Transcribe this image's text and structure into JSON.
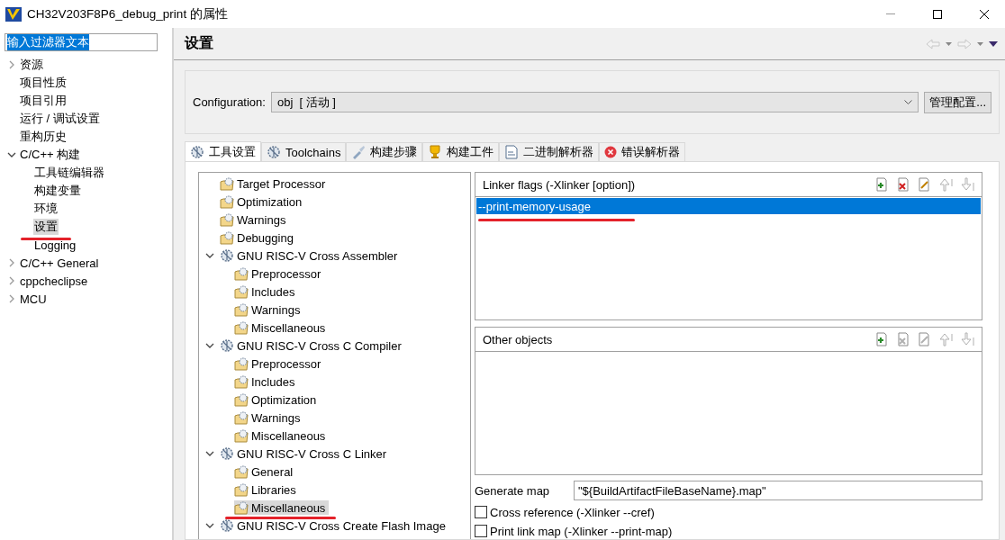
{
  "window": {
    "title": "CH32V203F8P6_debug_print 的属性"
  },
  "filter": {
    "value": "输入过滤器文本"
  },
  "nav_tree": [
    {
      "label": "资源",
      "expanded": false,
      "selected": false
    },
    {
      "label": "项目性质",
      "selected": false
    },
    {
      "label": "项目引用",
      "selected": false
    },
    {
      "label": "运行 / 调试设置",
      "selected": false
    },
    {
      "label": "重构历史",
      "selected": false
    },
    {
      "label": "C/C++ 构建",
      "expanded": true,
      "selected": false,
      "children": [
        {
          "label": "工具链编辑器",
          "selected": false
        },
        {
          "label": "构建变量",
          "selected": false
        },
        {
          "label": "环境",
          "selected": false
        },
        {
          "label": "设置",
          "selected": true,
          "underlined": true
        },
        {
          "label": "Logging",
          "selected": false
        }
      ]
    },
    {
      "label": "C/C++ General",
      "expanded": false,
      "selected": false
    },
    {
      "label": "cppcheclipse",
      "expanded": false,
      "selected": false
    },
    {
      "label": "MCU",
      "expanded": false,
      "selected": false
    }
  ],
  "page_title": "设置",
  "configuration": {
    "label": "Configuration:",
    "value": "obj  [ 活动 ]",
    "manage_button": "管理配置..."
  },
  "tabs": [
    {
      "label": "工具设置",
      "selected": true
    },
    {
      "label": "Toolchains",
      "selected": false
    },
    {
      "label": "构建步骤",
      "selected": false
    },
    {
      "label": "构建工件",
      "selected": false
    },
    {
      "label": "二进制解析器",
      "selected": false
    },
    {
      "label": "错误解析器",
      "selected": false
    }
  ],
  "tool_tree": [
    {
      "kind": "option",
      "label": "Target Processor",
      "selected": false
    },
    {
      "kind": "option",
      "label": "Optimization",
      "selected": false
    },
    {
      "kind": "option",
      "label": "Warnings",
      "selected": false
    },
    {
      "kind": "option",
      "label": "Debugging",
      "selected": false
    },
    {
      "kind": "tool",
      "label": "GNU RISC-V Cross Assembler",
      "expanded": true,
      "selected": false,
      "children": [
        {
          "kind": "option",
          "label": "Preprocessor",
          "selected": false
        },
        {
          "kind": "option",
          "label": "Includes",
          "selected": false
        },
        {
          "kind": "option",
          "label": "Warnings",
          "selected": false
        },
        {
          "kind": "option",
          "label": "Miscellaneous",
          "selected": false
        }
      ]
    },
    {
      "kind": "tool",
      "label": "GNU RISC-V Cross C Compiler",
      "expanded": true,
      "selected": false,
      "children": [
        {
          "kind": "option",
          "label": "Preprocessor",
          "selected": false
        },
        {
          "kind": "option",
          "label": "Includes",
          "selected": false
        },
        {
          "kind": "option",
          "label": "Optimization",
          "selected": false
        },
        {
          "kind": "option",
          "label": "Warnings",
          "selected": false
        },
        {
          "kind": "option",
          "label": "Miscellaneous",
          "selected": false
        }
      ]
    },
    {
      "kind": "tool",
      "label": "GNU RISC-V Cross C Linker",
      "expanded": true,
      "selected": false,
      "children": [
        {
          "kind": "option",
          "label": "General",
          "selected": false
        },
        {
          "kind": "option",
          "label": "Libraries",
          "selected": false
        },
        {
          "kind": "option",
          "label": "Miscellaneous",
          "selected": true,
          "underlined": true
        }
      ]
    },
    {
      "kind": "tool",
      "label": "GNU RISC-V Cross Create Flash Image",
      "expanded": true,
      "selected": false
    }
  ],
  "lists": [
    {
      "title": "Linker flags (-Xlinker [option])",
      "items": [
        {
          "text": "--print-memory-usage",
          "selected": true,
          "underlined": true
        }
      ]
    },
    {
      "title": "Other objects"
    }
  ],
  "generate_map": {
    "label": "Generate map",
    "value": "\"${BuildArtifactFileBaseName}.map\""
  },
  "checkboxes": [
    {
      "label": "Cross reference (-Xlinker --cref)",
      "checked": false
    },
    {
      "label": "Print link map (-Xlinker --print-map)",
      "checked": false
    }
  ]
}
